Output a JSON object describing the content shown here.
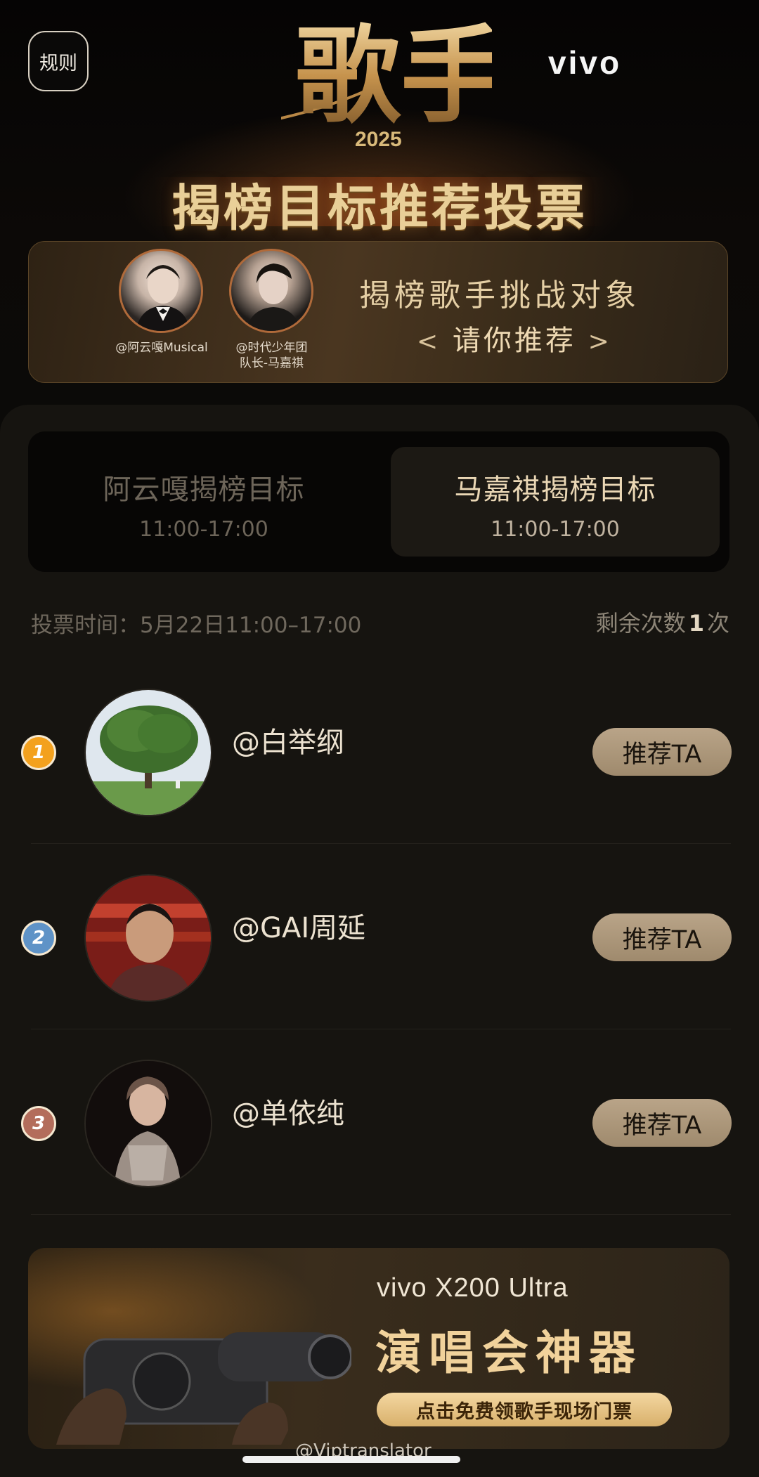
{
  "header": {
    "rules_label": "规则",
    "brand": "vivo",
    "show_name": "歌手",
    "show_year": "2025",
    "title": "揭榜目标推荐投票"
  },
  "banner": {
    "guests": [
      {
        "name": "@阿云嘎Musical"
      },
      {
        "name": "@时代少年团\n队长-马嘉祺"
      }
    ],
    "line1": "揭榜歌手挑战对象",
    "line2": "请你推荐",
    "chevron_left": "<",
    "chevron_right": ">"
  },
  "tabs": [
    {
      "label": "阿云嘎揭榜目标",
      "time": "11:00-17:00",
      "active": false
    },
    {
      "label": "马嘉祺揭榜目标",
      "time": "11:00-17:00",
      "active": true
    }
  ],
  "vote": {
    "time_text": "投票时间：5月22日11:00–17:00",
    "remaining_prefix": "剩余次数",
    "remaining_count": "1",
    "remaining_suffix": "次"
  },
  "candidates": [
    {
      "rank": "1",
      "name": "@白举纲",
      "button": "推荐TA"
    },
    {
      "rank": "2",
      "name": "@GAI周延",
      "button": "推荐TA"
    },
    {
      "rank": "3",
      "name": "@单依纯",
      "button": "推荐TA"
    }
  ],
  "promo": {
    "title": "vivo X200 Ultra",
    "headline": "演唱会神器",
    "cta": "点击免费领歌手现场门票"
  },
  "watermark": "@Viptranslator",
  "colors": {
    "background": "#0b0a08",
    "card": "#161410",
    "gold_accent": "#e9cf98",
    "button": "#b9a488",
    "rank_1": "#f3a11e",
    "rank_2": "#5f93c7",
    "rank_3": "#b36d5b"
  }
}
